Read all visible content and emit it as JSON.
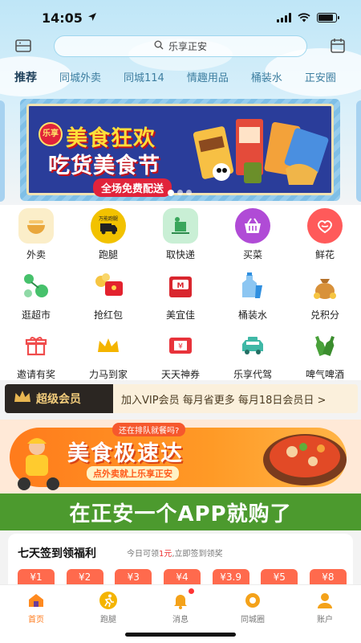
{
  "status_bar": {
    "time": "14:05",
    "battery_level": 0.85
  },
  "search": {
    "placeholder": "乐享正安"
  },
  "tabs": [
    {
      "label": "推荐",
      "active": true
    },
    {
      "label": "同城外卖"
    },
    {
      "label": "同城114"
    },
    {
      "label": "情趣用品"
    },
    {
      "label": "桶装水"
    },
    {
      "label": "正安圈"
    }
  ],
  "banner": {
    "badge": "乐享",
    "title1": "美食狂欢",
    "title2": "吃货美食节",
    "tag": "全场免费配送",
    "slides": 3,
    "active_slide": 0
  },
  "grid": [
    {
      "label": "外卖",
      "icon": "takeout-bowl-icon",
      "color": "#f4d58d"
    },
    {
      "label": "跑腿",
      "icon": "errand-truck-icon",
      "color": "#f2c200",
      "badge": "万能跑腿"
    },
    {
      "label": "取快递",
      "icon": "package-pickup-icon",
      "color": "#7fd19a"
    },
    {
      "label": "买菜",
      "icon": "basket-icon",
      "color": "#b04bd6"
    },
    {
      "label": "鲜花",
      "icon": "flower-icon",
      "color": "#ff5a5a"
    },
    {
      "label": "逛超市",
      "icon": "supermarket-icon",
      "color": "#46c16b"
    },
    {
      "label": "抢红包",
      "icon": "red-packet-icon",
      "color": "#e3222e"
    },
    {
      "label": "美宜佳",
      "icon": "meiyijia-icon",
      "color": "#d9262e"
    },
    {
      "label": "桶装水",
      "icon": "water-bottle-icon",
      "color": "#2f8fe0"
    },
    {
      "label": "兑积分",
      "icon": "points-sack-icon",
      "color": "#d8913a"
    },
    {
      "label": "邀请有奖",
      "icon": "gift-icon",
      "color": "#f04c4c"
    },
    {
      "label": "力马到家",
      "icon": "crown-icon",
      "color": "#f4b400"
    },
    {
      "label": "天天神券",
      "icon": "coupon-icon",
      "color": "#e8333b"
    },
    {
      "label": "乐享代驾",
      "icon": "car-icon",
      "color": "#3fb8a6"
    },
    {
      "label": "啤气啤酒",
      "icon": "beer-bottles-icon",
      "color": "#49a13a"
    }
  ],
  "vip": {
    "title": "超级会员",
    "text": "加入VIP会员 每月省更多 每月18日会员日 >"
  },
  "promo": {
    "bubble": "还在排队就餐吗?",
    "title": "美食极速达",
    "sub": "点外卖就上乐享正安"
  },
  "slogan": "在正安一个APP就购了",
  "signin": {
    "title": "七天签到领福利",
    "sub_prefix": "今日可领",
    "sub_amount": "1元",
    "sub_suffix": ",立即签到领奖",
    "coins": [
      "¥1",
      "¥2",
      "¥3",
      "¥4",
      "¥3.9",
      "¥5",
      "¥8"
    ]
  },
  "nav": [
    {
      "label": "首页",
      "icon": "home-icon",
      "active": true
    },
    {
      "label": "跑腿",
      "icon": "runner-icon"
    },
    {
      "label": "消息",
      "icon": "bell-icon",
      "dot": true
    },
    {
      "label": "同城圈",
      "icon": "donut-icon"
    },
    {
      "label": "账户",
      "icon": "user-icon"
    }
  ],
  "colors": {
    "accent": "#ff7b1c",
    "slogan_green": "#4c9a2e",
    "vip_gold": "#f3cd7c",
    "coin_red": "#ff6a4d"
  }
}
